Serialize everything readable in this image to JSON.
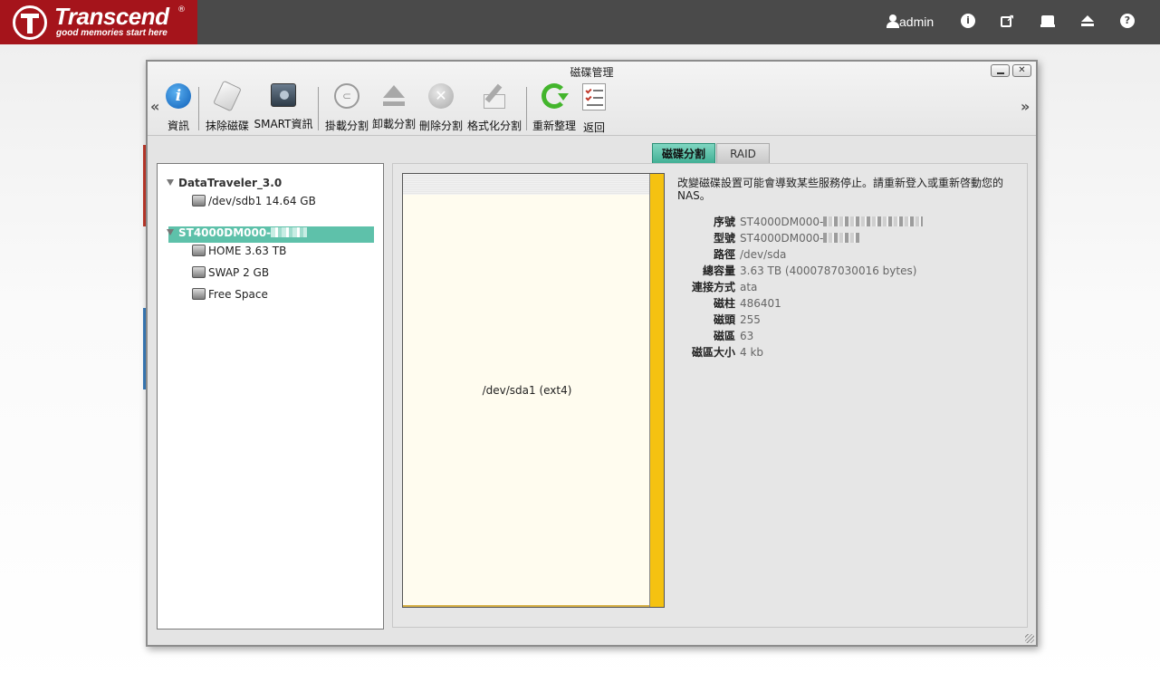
{
  "topbar": {
    "logo_name": "Transcend",
    "logo_reg": "®",
    "logo_tagline": "good memories start here",
    "user": "admin",
    "icons": [
      "user-icon",
      "info-icon",
      "external-link-icon",
      "disk-icon",
      "eject-icon",
      "help-icon"
    ],
    "info_glyph": "i",
    "help_glyph": "?"
  },
  "window": {
    "title": "磁碟管理",
    "close_glyph": "✕",
    "scroll_left": "«",
    "scroll_right": "»"
  },
  "toolbar": {
    "info": "資訊",
    "erase": "抹除磁碟",
    "smart": "SMART資訊",
    "mount": "掛載分割",
    "unmount": "卸載分割",
    "delete": "刪除分割",
    "format": "格式化分割",
    "refresh": "重新整理",
    "back": "返回"
  },
  "tabs": {
    "partition": "磁碟分割",
    "raid": "RAID"
  },
  "tree": {
    "device1": "DataTraveler_3.0",
    "device1_part": "/dev/sdb1 14.64 GB",
    "device2": "ST4000DM000-",
    "device2_parts": [
      "HOME 3.63 TB",
      "SWAP 2 GB",
      "Free Space"
    ]
  },
  "partition_map": {
    "label": "/dev/sda1 (ext4)"
  },
  "details": {
    "warning": "改變磁碟設置可能會導致某些服務停止。請重新登入或重新啓動您的NAS。",
    "rows": [
      {
        "key": "序號",
        "value": "ST4000DM000-"
      },
      {
        "key": "型號",
        "value": "ST4000DM000-"
      },
      {
        "key": "路徑",
        "value": "/dev/sda"
      },
      {
        "key": "總容量",
        "value": "3.63 TB (4000787030016 bytes)"
      },
      {
        "key": "連接方式",
        "value": "ata"
      },
      {
        "key": "磁柱",
        "value": "486401"
      },
      {
        "key": "磁頭",
        "value": "255"
      },
      {
        "key": "磁區",
        "value": "63"
      },
      {
        "key": "磁區大小",
        "value": "4 kb"
      }
    ]
  },
  "colors": {
    "brand_red": "#a5141b",
    "topbar": "#4a4a4a",
    "tab_active": "#5ec1aa",
    "partition_strip": "#f5c211"
  }
}
